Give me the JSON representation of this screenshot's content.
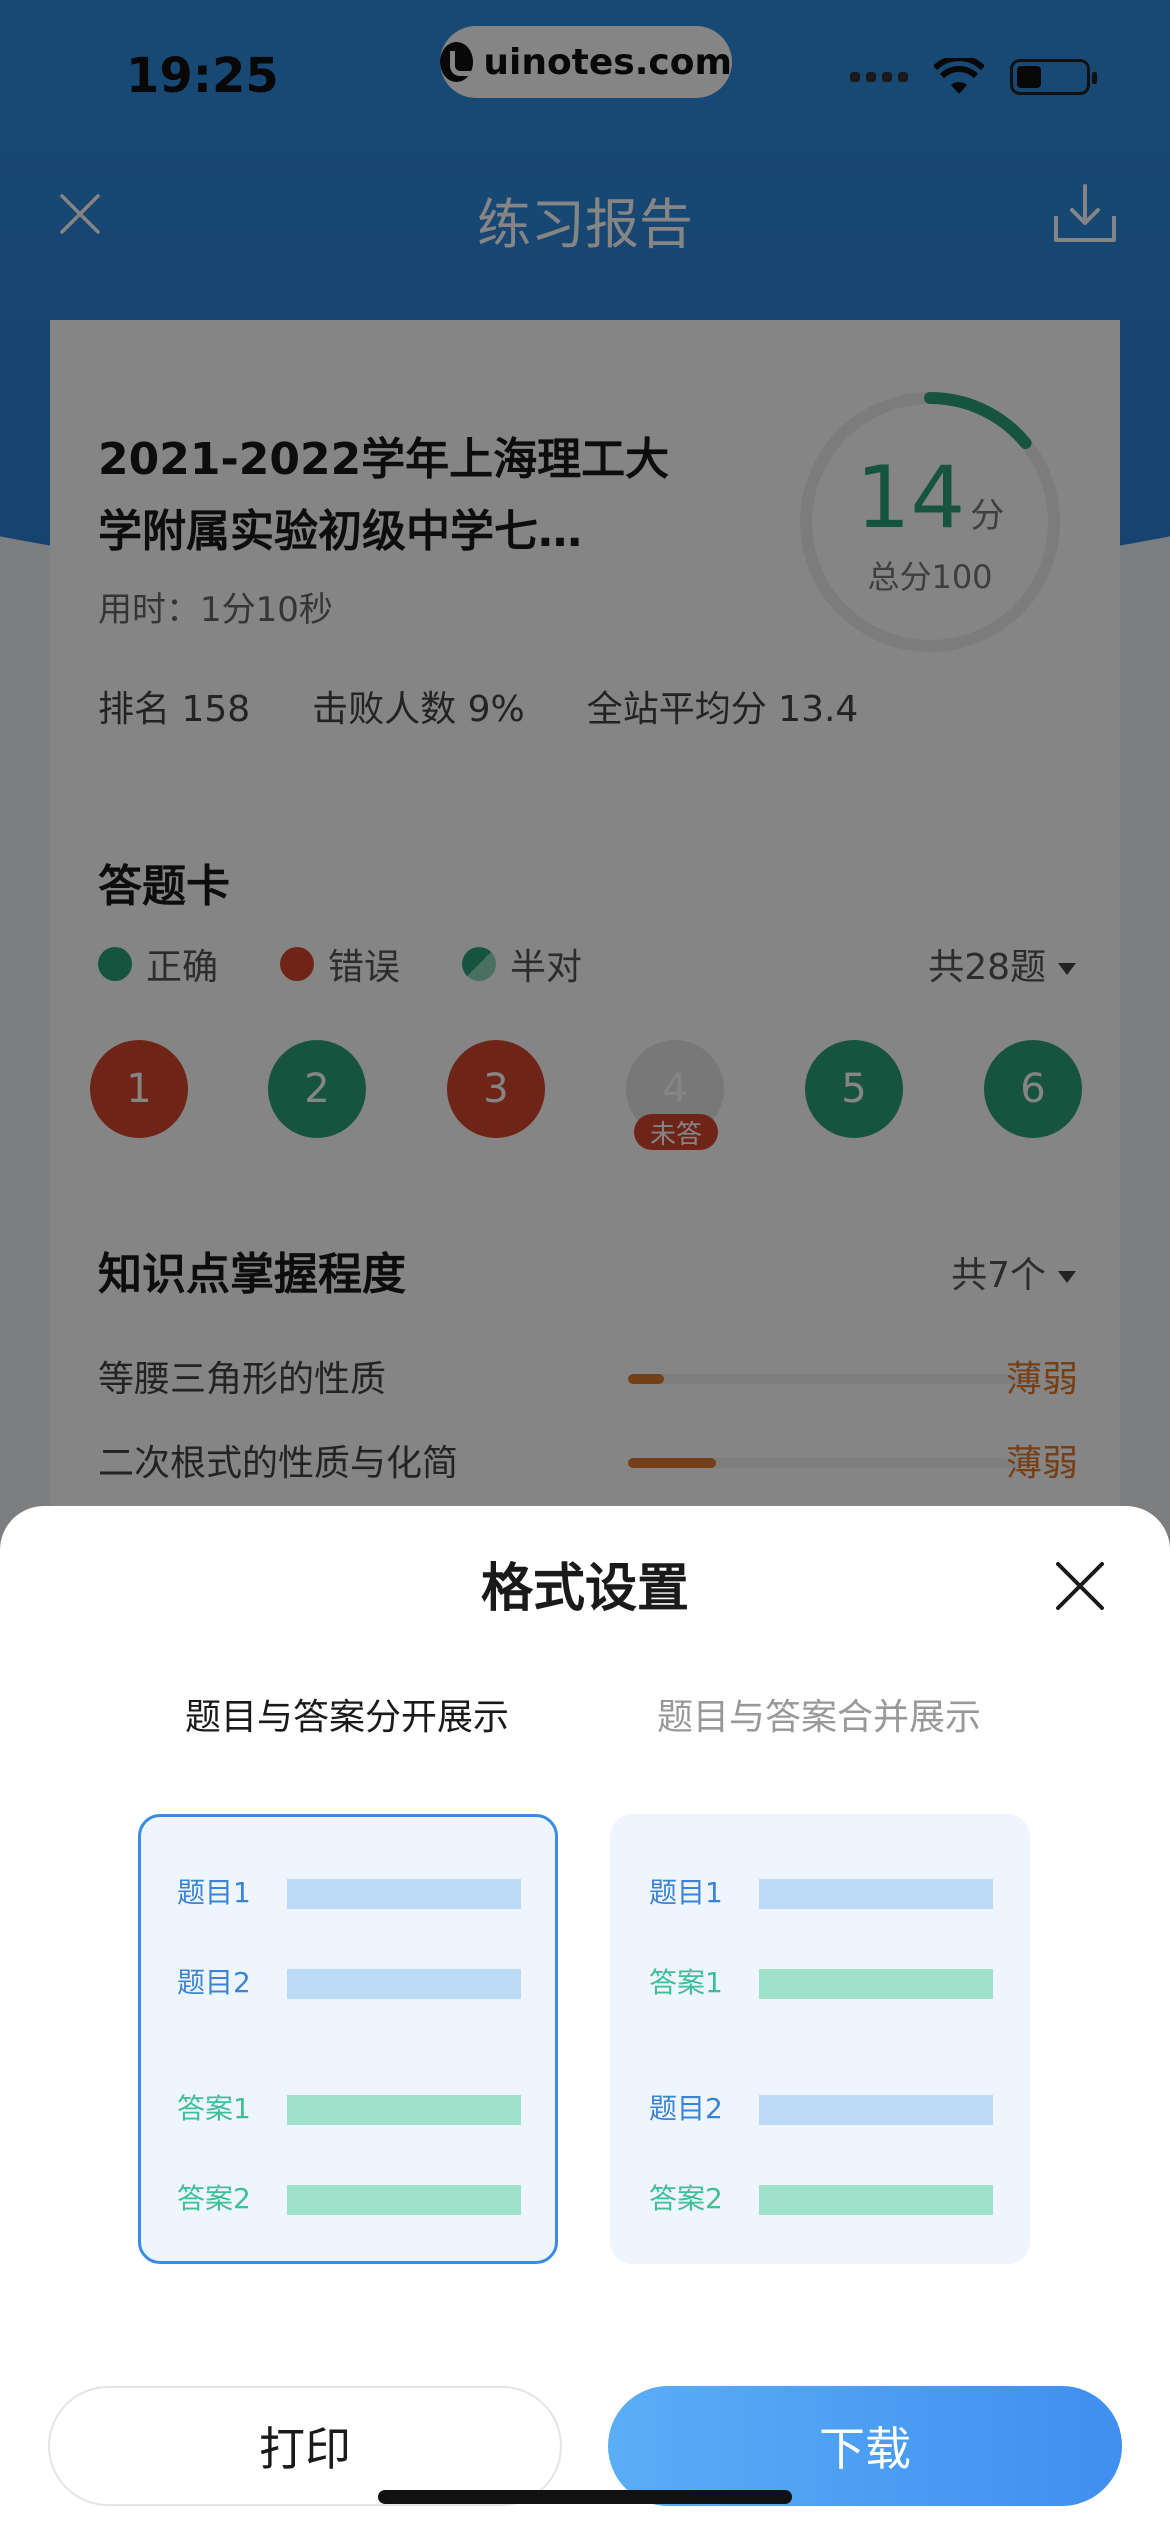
{
  "status_bar": {
    "time": "19:25"
  },
  "watermark": {
    "text": "uinotes.com"
  },
  "nav": {
    "title": "练习报告"
  },
  "report": {
    "title": "2021-2022学年上海理工大学附属实验初级中学七…",
    "time_used": "用时：1分10秒",
    "stats": [
      "排名 158",
      "击败人数 9%",
      "全站平均分 13.4"
    ],
    "score": {
      "value": "14",
      "unit": "分",
      "total": "总分100",
      "fraction": 0.14,
      "color": "#2ca279"
    }
  },
  "answer_card": {
    "title": "答题卡",
    "legend": [
      {
        "label": "正确",
        "color": "#2ca279"
      },
      {
        "label": "错误",
        "color": "#d4472e"
      },
      {
        "label": "半对",
        "color": "#2ca279"
      }
    ],
    "total": "共28题",
    "items": [
      {
        "num": "1",
        "color": "#d4472e"
      },
      {
        "num": "2",
        "color": "#2ca279"
      },
      {
        "num": "3",
        "color": "#d4472e"
      },
      {
        "num": "4",
        "color": "#e6e6e6",
        "tag": "未答"
      },
      {
        "num": "5",
        "color": "#2ca279"
      },
      {
        "num": "6",
        "color": "#2ca279"
      }
    ]
  },
  "knowledge": {
    "title": "知识点掌握程度",
    "total": "共7个",
    "items": [
      {
        "label": "等腰三角形的性质",
        "level": "薄弱",
        "fraction": 0.09
      },
      {
        "label": "二次根式的性质与化简",
        "level": "薄弱",
        "fraction": 0.22
      }
    ]
  },
  "sheet": {
    "title": "格式设置",
    "options": [
      {
        "label": "题目与答案分开展示",
        "rows": [
          "题目1",
          "题目2",
          "答案1",
          "答案2"
        ]
      },
      {
        "label": "题目与答案合并展示",
        "rows": [
          "题目1",
          "答案1",
          "题目2",
          "答案2"
        ]
      }
    ],
    "print_label": "打印",
    "download_label": "下载"
  }
}
